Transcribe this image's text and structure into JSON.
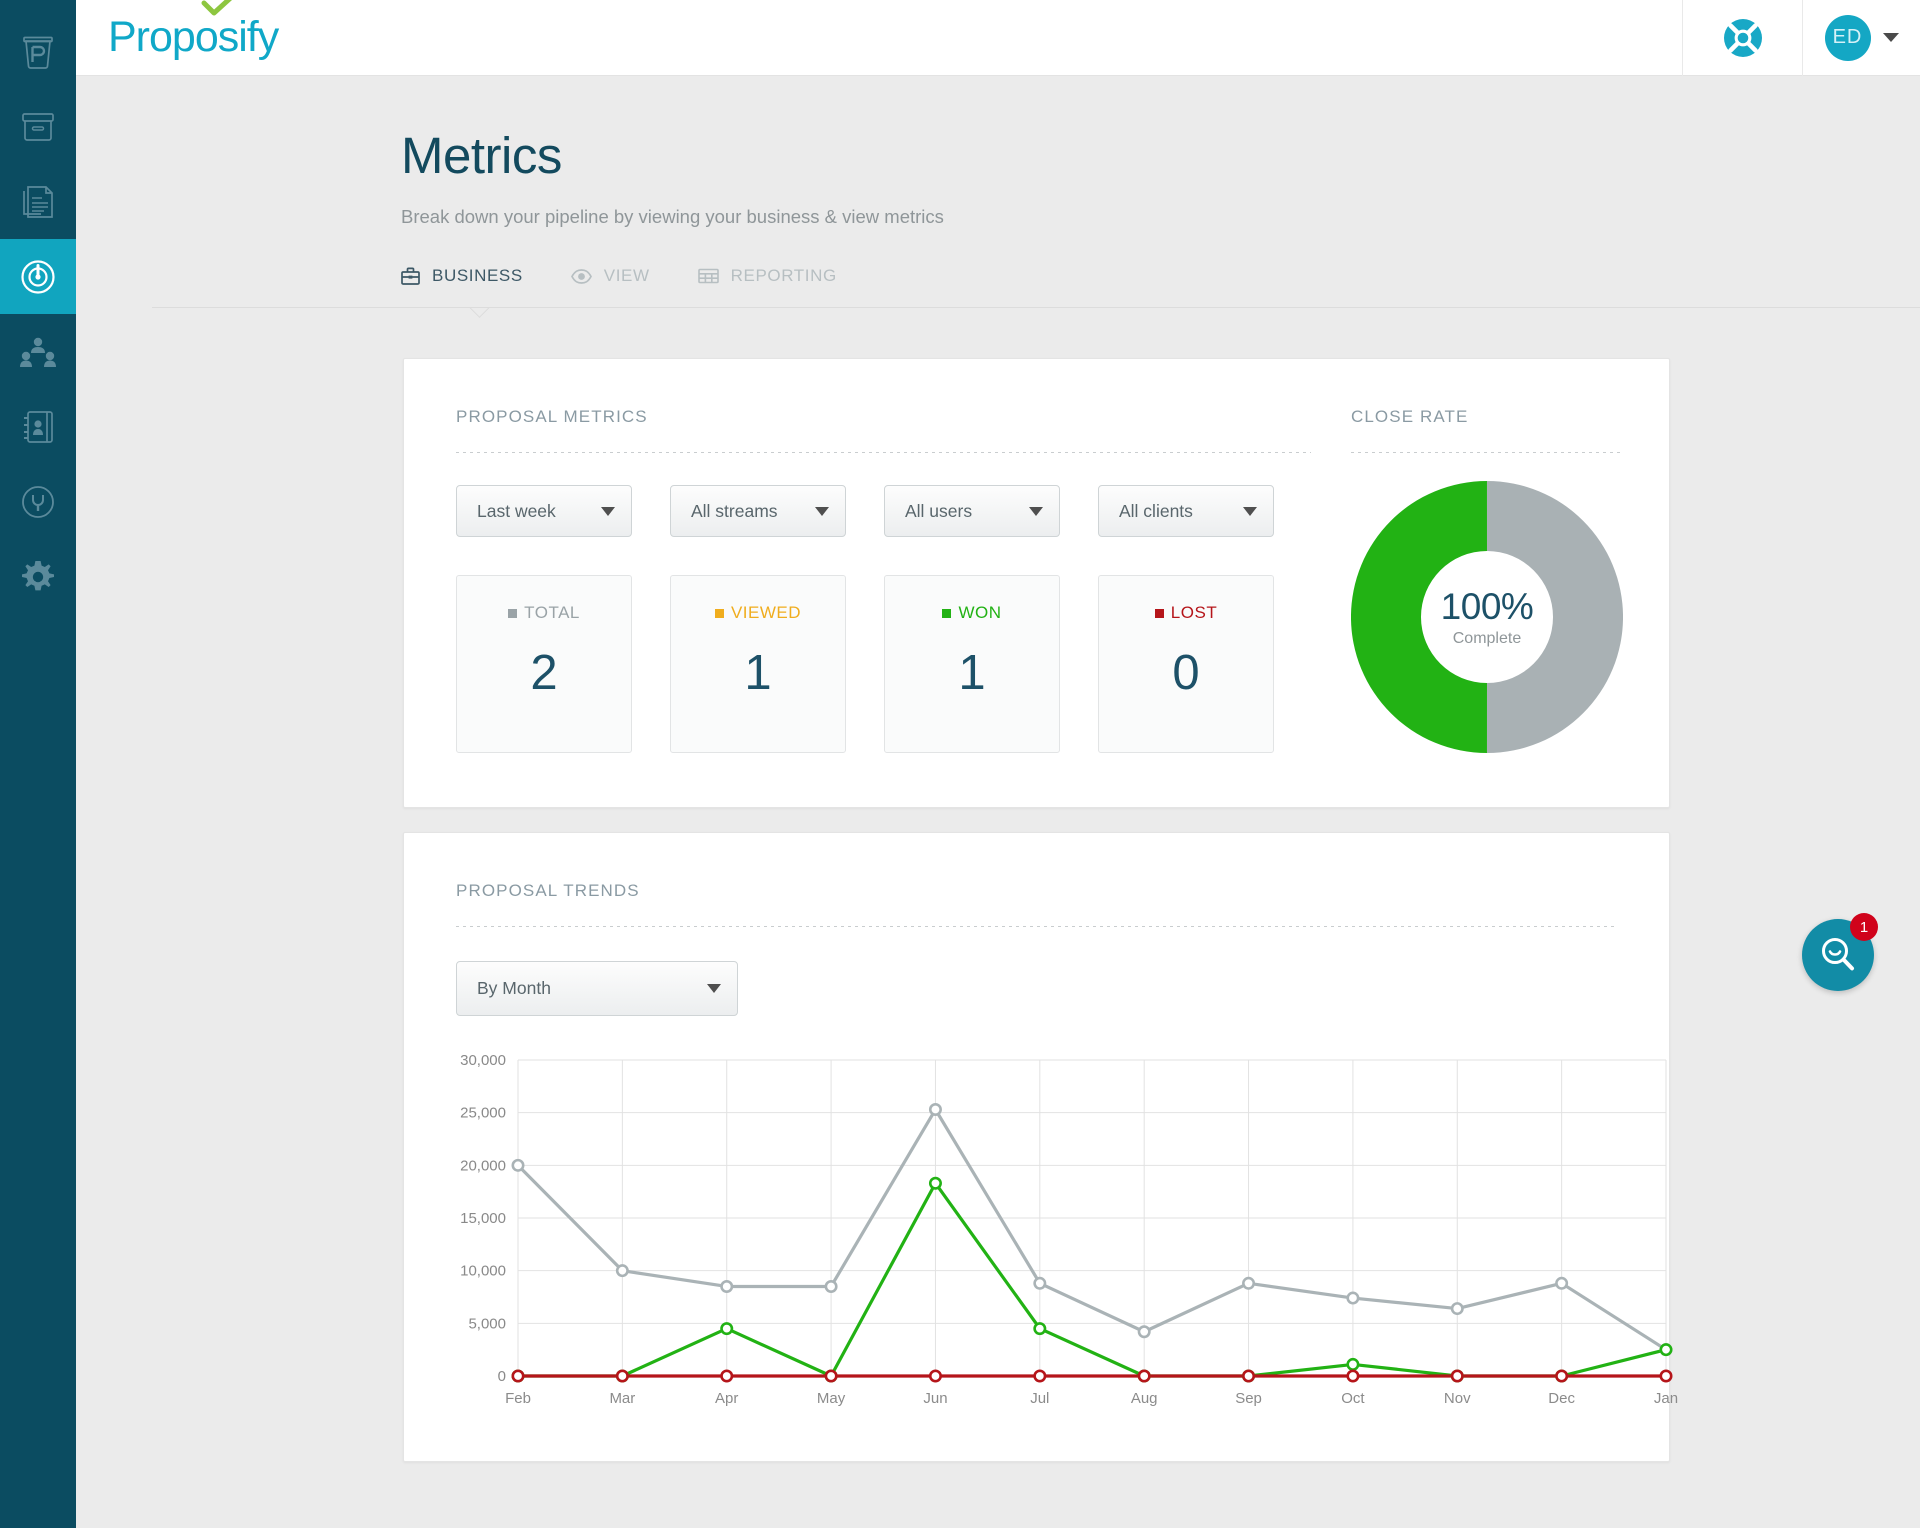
{
  "brand": {
    "logo_text": "Proposify",
    "logo_color": "#10a8c8",
    "check_color": "#8dc63f",
    "accent": "#11a5bf"
  },
  "sidebar": {
    "items": [
      {
        "name": "coffee-cup-p-icon",
        "label": "Proposify Home",
        "active": false
      },
      {
        "name": "archive-box-icon",
        "label": "Archive",
        "active": false
      },
      {
        "name": "documents-icon",
        "label": "Documents",
        "active": false
      },
      {
        "name": "target-metrics-icon",
        "label": "Metrics",
        "active": true
      },
      {
        "name": "team-people-icon",
        "label": "Team",
        "active": false
      },
      {
        "name": "contacts-book-icon",
        "label": "Contacts",
        "active": false
      },
      {
        "name": "plug-integrations-icon",
        "label": "Integrations",
        "active": false
      },
      {
        "name": "gear-settings-icon",
        "label": "Settings",
        "active": false
      }
    ]
  },
  "topbar": {
    "help_icon": "lifebuoy-icon",
    "user_initials": "ED",
    "user_menu_icon": "caret-down-icon"
  },
  "header": {
    "title": "Metrics",
    "subtitle": "Break down your pipeline by viewing your business & view metrics"
  },
  "tabs": [
    {
      "label": "BUSINESS",
      "icon": "briefcase-icon",
      "active": true
    },
    {
      "label": "VIEW",
      "icon": "eye-icon",
      "active": false
    },
    {
      "label": "REPORTING",
      "icon": "table-grid-icon",
      "active": false
    }
  ],
  "proposal_metrics": {
    "section_title": "PROPOSAL METRICS",
    "filters": [
      {
        "name": "date-range-select",
        "value": "Last week"
      },
      {
        "name": "streams-select",
        "value": "All streams"
      },
      {
        "name": "users-select",
        "value": "All users"
      },
      {
        "name": "clients-select",
        "value": "All clients"
      }
    ],
    "stats": [
      {
        "label": "TOTAL",
        "value": "2",
        "color": "#9aa3a7"
      },
      {
        "label": "VIEWED",
        "value": "1",
        "color": "#f0ad1e"
      },
      {
        "label": "WON",
        "value": "1",
        "color": "#22b214"
      },
      {
        "label": "LOST",
        "value": "0",
        "color": "#b5151a"
      }
    ]
  },
  "close_rate": {
    "section_title": "CLOSE RATE",
    "percent_label": "100%",
    "caption": "Complete",
    "filled_fraction": 0.5,
    "filled_color": "#22b214",
    "track_color": "#a9b1b4"
  },
  "proposal_trends": {
    "section_title": "PROPOSAL TRENDS",
    "grouping_select": {
      "name": "grouping-select",
      "value": "By Month"
    }
  },
  "beacon": {
    "icon": "search-smile-icon",
    "badge": "1"
  },
  "chart_data": {
    "type": "line",
    "title": "",
    "xlabel": "",
    "ylabel": "",
    "categories": [
      "Feb",
      "Mar",
      "Apr",
      "May",
      "Jun",
      "Jul",
      "Aug",
      "Sep",
      "Oct",
      "Nov",
      "Dec",
      "Jan"
    ],
    "ylim": [
      0,
      30000
    ],
    "yticks": [
      0,
      5000,
      10000,
      15000,
      20000,
      25000,
      30000
    ],
    "ytick_labels": [
      "0",
      "5,000",
      "10,000",
      "15,000",
      "20,000",
      "25,000",
      "30,000"
    ],
    "grid": true,
    "legend": "none",
    "series": [
      {
        "name": "Total",
        "color": "#aab3b6",
        "values": [
          20000,
          10000,
          8500,
          8500,
          25300,
          8800,
          4200,
          8800,
          7400,
          6400,
          8800,
          2500
        ]
      },
      {
        "name": "Won",
        "color": "#22b214",
        "values": [
          0,
          0,
          4500,
          0,
          18300,
          4500,
          0,
          0,
          1100,
          0,
          0,
          2500
        ]
      },
      {
        "name": "Lost",
        "color": "#b5151a",
        "values": [
          0,
          0,
          0,
          0,
          0,
          0,
          0,
          0,
          0,
          0,
          0,
          0
        ]
      }
    ]
  }
}
